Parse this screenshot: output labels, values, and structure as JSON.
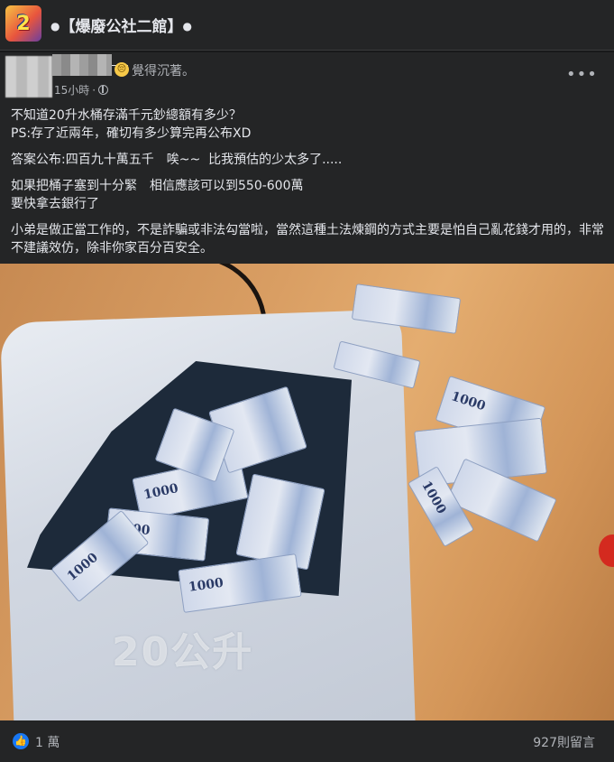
{
  "group": {
    "title": "【爆廢公社二館】",
    "dot": "●",
    "logo_glyph": "2"
  },
  "post": {
    "feeling_emoji": "😔",
    "feeling": "覺得沉著。",
    "time": "15小時",
    "time_separator": "·",
    "more": "•••",
    "paragraphs": [
      "不知道20升水桶存滿千元鈔總額有多少？\nPS:存了近兩年，確切有多少算完再公布XD",
      "答案公布:四百九十萬五千　唉~~  比我預估的少太多了.....",
      "如果把桶子塞到十分緊　相信應該可以到550-600萬\n要快拿去銀行了",
      "小弟是做正當工作的，不是詐騙或非法勾當啦，當然這種土法煉鋼的方式主要是怕自己亂花錢才用的，非常不建議效仿，除非你家百分百安全。"
    ],
    "photo": {
      "bucket_label": "20公升",
      "note_denomination": "1000"
    }
  },
  "footer": {
    "like_icon": "👍",
    "likes": "1 萬",
    "comments": "927則留言"
  },
  "colors": {
    "background": "#18191a",
    "card": "#242526",
    "text": "#e4e6eb",
    "secondary_text": "#b0b3b8",
    "like_blue": "#1877f2"
  }
}
